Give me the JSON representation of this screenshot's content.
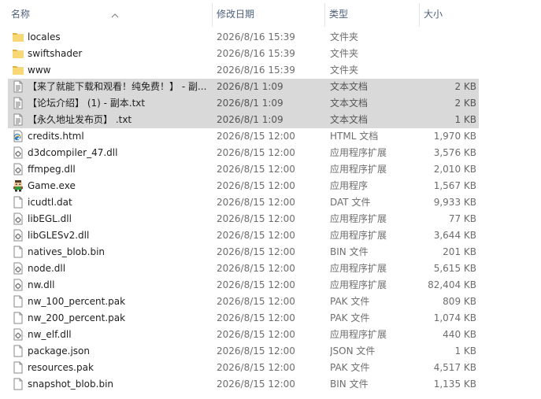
{
  "columns": {
    "name": "名称",
    "date": "修改日期",
    "type": "类型",
    "size": "大小"
  },
  "files": [
    {
      "name": "locales",
      "date": "2026/8/16 15:39",
      "type": "文件夹",
      "size": "",
      "icon": "folder-icon",
      "selected": false
    },
    {
      "name": "swiftshader",
      "date": "2026/8/16 15:39",
      "type": "文件夹",
      "size": "",
      "icon": "folder-icon",
      "selected": false
    },
    {
      "name": "www",
      "date": "2026/8/16 15:39",
      "type": "文件夹",
      "size": "",
      "icon": "folder-icon",
      "selected": false
    },
    {
      "name": "【来了就能下载和观看！纯免费！】 - 副...",
      "date": "2026/8/1 1:09",
      "type": "文本文档",
      "size": "2 KB",
      "icon": "text-file-icon",
      "selected": true
    },
    {
      "name": "【论坛介绍】 (1) - 副本.txt",
      "date": "2026/8/1 1:09",
      "type": "文本文档",
      "size": "2 KB",
      "icon": "text-file-icon",
      "selected": true
    },
    {
      "name": "【永久地址发布页】 .txt",
      "date": "2026/8/1 1:09",
      "type": "文本文档",
      "size": "1 KB",
      "icon": "text-file-icon",
      "selected": true
    },
    {
      "name": "credits.html",
      "date": "2026/8/15 12:00",
      "type": "HTML 文档",
      "size": "1,970 KB",
      "icon": "html-file-icon",
      "selected": false
    },
    {
      "name": "d3dcompiler_47.dll",
      "date": "2026/8/15 12:00",
      "type": "应用程序扩展",
      "size": "3,576 KB",
      "icon": "dll-file-icon",
      "selected": false
    },
    {
      "name": "ffmpeg.dll",
      "date": "2026/8/15 12:00",
      "type": "应用程序扩展",
      "size": "2,010 KB",
      "icon": "dll-file-icon",
      "selected": false
    },
    {
      "name": "Game.exe",
      "date": "2026/8/15 12:00",
      "type": "应用程序",
      "size": "1,567 KB",
      "icon": "game-exe-icon",
      "selected": false
    },
    {
      "name": "icudtl.dat",
      "date": "2026/8/15 12:00",
      "type": "DAT 文件",
      "size": "9,933 KB",
      "icon": "blank-file-icon",
      "selected": false
    },
    {
      "name": "libEGL.dll",
      "date": "2026/8/15 12:00",
      "type": "应用程序扩展",
      "size": "77 KB",
      "icon": "dll-file-icon",
      "selected": false
    },
    {
      "name": "libGLESv2.dll",
      "date": "2026/8/15 12:00",
      "type": "应用程序扩展",
      "size": "3,644 KB",
      "icon": "dll-file-icon",
      "selected": false
    },
    {
      "name": "natives_blob.bin",
      "date": "2026/8/15 12:00",
      "type": "BIN 文件",
      "size": "201 KB",
      "icon": "blank-file-icon",
      "selected": false
    },
    {
      "name": "node.dll",
      "date": "2026/8/15 12:00",
      "type": "应用程序扩展",
      "size": "5,615 KB",
      "icon": "dll-file-icon",
      "selected": false
    },
    {
      "name": "nw.dll",
      "date": "2026/8/15 12:00",
      "type": "应用程序扩展",
      "size": "82,404 KB",
      "icon": "dll-file-icon",
      "selected": false
    },
    {
      "name": "nw_100_percent.pak",
      "date": "2026/8/15 12:00",
      "type": "PAK 文件",
      "size": "809 KB",
      "icon": "blank-file-icon",
      "selected": false
    },
    {
      "name": "nw_200_percent.pak",
      "date": "2026/8/15 12:00",
      "type": "PAK 文件",
      "size": "1,074 KB",
      "icon": "blank-file-icon",
      "selected": false
    },
    {
      "name": "nw_elf.dll",
      "date": "2026/8/15 12:00",
      "type": "应用程序扩展",
      "size": "440 KB",
      "icon": "dll-file-icon",
      "selected": false
    },
    {
      "name": "package.json",
      "date": "2026/8/15 12:00",
      "type": "JSON 文件",
      "size": "1 KB",
      "icon": "blank-file-icon",
      "selected": false
    },
    {
      "name": "resources.pak",
      "date": "2026/8/15 12:00",
      "type": "PAK 文件",
      "size": "4,517 KB",
      "icon": "blank-file-icon",
      "selected": false
    },
    {
      "name": "snapshot_blob.bin",
      "date": "2026/8/15 12:00",
      "type": "BIN 文件",
      "size": "1,135 KB",
      "icon": "blank-file-icon",
      "selected": false
    }
  ],
  "colors": {
    "header_text": "#4c607a",
    "selection": "#d9d9d9",
    "folder": "#f8d775",
    "folder_dark": "#e0b341"
  }
}
